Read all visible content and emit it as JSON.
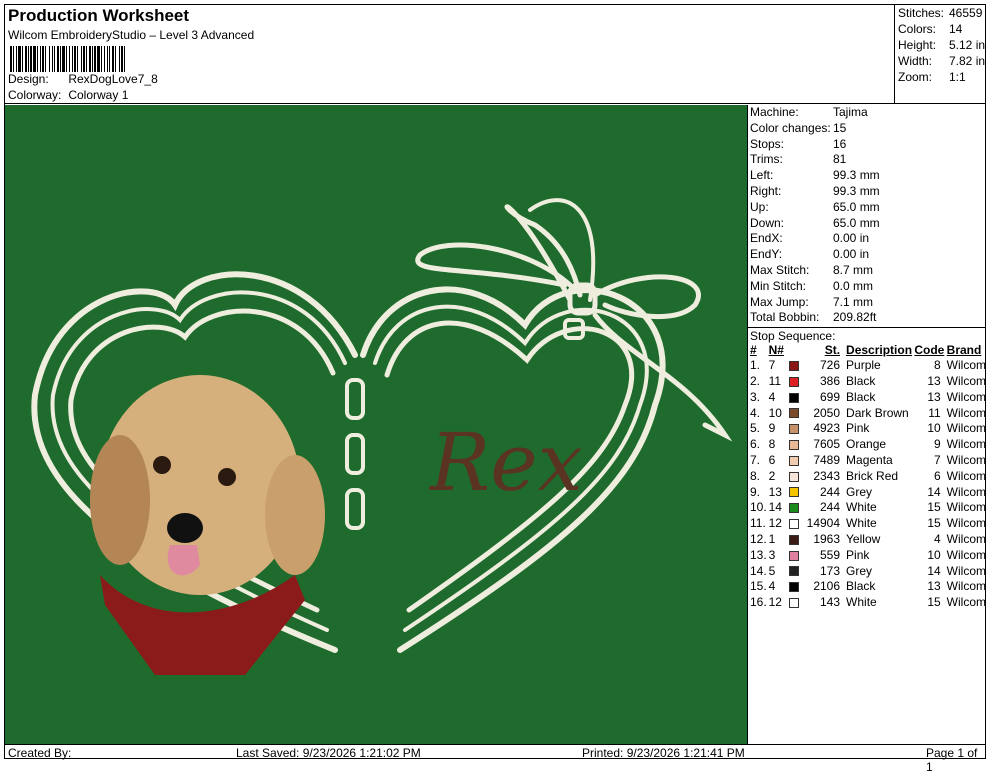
{
  "header": {
    "title": "Production Worksheet",
    "subtitle": "Wilcom EmbroideryStudio – Level 3 Advanced",
    "design_label": "Design:",
    "design_value": "RexDogLove7_8",
    "colorway_label": "Colorway:",
    "colorway_value": "Colorway 1"
  },
  "stats": [
    {
      "label": "Stitches:",
      "value": "46559"
    },
    {
      "label": "Colors:",
      "value": "14"
    },
    {
      "label": "Height:",
      "value": "5.12 in"
    },
    {
      "label": "Width:",
      "value": "7.82 in"
    },
    {
      "label": "Zoom:",
      "value": "1:1"
    }
  ],
  "machine": [
    {
      "label": "Machine:",
      "value": "Tajima"
    },
    {
      "label": "Color changes:",
      "value": "15"
    },
    {
      "label": "Stops:",
      "value": "16"
    },
    {
      "label": "Trims:",
      "value": "81"
    },
    {
      "label": "Left:",
      "value": "99.3 mm"
    },
    {
      "label": "Right:",
      "value": "99.3 mm"
    },
    {
      "label": "Up:",
      "value": "65.0 mm"
    },
    {
      "label": "Down:",
      "value": "65.0 mm"
    },
    {
      "label": "EndX:",
      "value": "0.00 in"
    },
    {
      "label": "EndY:",
      "value": "0.00 in"
    },
    {
      "label": "Max Stitch:",
      "value": "8.7 mm"
    },
    {
      "label": "Min Stitch:",
      "value": "0.0 mm"
    },
    {
      "label": "Max Jump:",
      "value": "7.1 mm"
    },
    {
      "label": "Total Bobbin:",
      "value": "209.82ft"
    }
  ],
  "stop_sequence": {
    "title": "Stop Sequence:",
    "headers": [
      "#",
      "N#",
      "St.",
      "Description",
      "Code",
      "Brand"
    ],
    "rows": [
      {
        "idx": "1.",
        "n": "7",
        "color": "#8b1414",
        "st": "726",
        "desc": "Purple",
        "code": "8",
        "brand": "Wilcom"
      },
      {
        "idx": "2.",
        "n": "11",
        "color": "#e02020",
        "st": "386",
        "desc": "Black",
        "code": "13",
        "brand": "Wilcom"
      },
      {
        "idx": "3.",
        "n": "4",
        "color": "#000000",
        "st": "699",
        "desc": "Black",
        "code": "13",
        "brand": "Wilcom"
      },
      {
        "idx": "4.",
        "n": "10",
        "color": "#7a4a2a",
        "st": "2050",
        "desc": "Dark Brown",
        "code": "11",
        "brand": "Wilcom"
      },
      {
        "idx": "5.",
        "n": "9",
        "color": "#c8916a",
        "st": "4923",
        "desc": "Pink",
        "code": "10",
        "brand": "Wilcom"
      },
      {
        "idx": "6.",
        "n": "8",
        "color": "#e8b896",
        "st": "7605",
        "desc": "Orange",
        "code": "9",
        "brand": "Wilcom"
      },
      {
        "idx": "7.",
        "n": "6",
        "color": "#f0cdb0",
        "st": "7489",
        "desc": "Magenta",
        "code": "7",
        "brand": "Wilcom"
      },
      {
        "idx": "8.",
        "n": "2",
        "color": "#f8e4d8",
        "st": "2343",
        "desc": "Brick Red",
        "code": "6",
        "brand": "Wilcom"
      },
      {
        "idx": "9.",
        "n": "13",
        "color": "#f5c400",
        "st": "244",
        "desc": "Grey",
        "code": "14",
        "brand": "Wilcom"
      },
      {
        "idx": "10.",
        "n": "14",
        "color": "#1a8a1a",
        "st": "244",
        "desc": "White",
        "code": "15",
        "brand": "Wilcom"
      },
      {
        "idx": "11.",
        "n": "12",
        "color": "#ffffff",
        "st": "14904",
        "desc": "White",
        "code": "15",
        "brand": "Wilcom"
      },
      {
        "idx": "12.",
        "n": "1",
        "color": "#3a1a14",
        "st": "1963",
        "desc": "Yellow",
        "code": "4",
        "brand": "Wilcom"
      },
      {
        "idx": "13.",
        "n": "3",
        "color": "#e080a0",
        "st": "559",
        "desc": "Pink",
        "code": "10",
        "brand": "Wilcom"
      },
      {
        "idx": "14.",
        "n": "5",
        "color": "#222222",
        "st": "173",
        "desc": "Grey",
        "code": "14",
        "brand": "Wilcom"
      },
      {
        "idx": "15.",
        "n": "4",
        "color": "#000000",
        "st": "2106",
        "desc": "Black",
        "code": "13",
        "brand": "Wilcom"
      },
      {
        "idx": "16.",
        "n": "12",
        "color": "#ffffff",
        "st": "143",
        "desc": "White",
        "code": "15",
        "brand": "Wilcom"
      }
    ]
  },
  "design": {
    "background": "#1f6b2d",
    "thread_white": "#efeede",
    "name_text": "Rex",
    "name_color": "#5a3322"
  },
  "footer": {
    "created_by": "Created By:",
    "last_saved": "Last Saved: 9/23/2026 1:21:02 PM",
    "printed": "Printed: 9/23/2026 1:21:41 PM",
    "page": "Page 1 of 1"
  }
}
